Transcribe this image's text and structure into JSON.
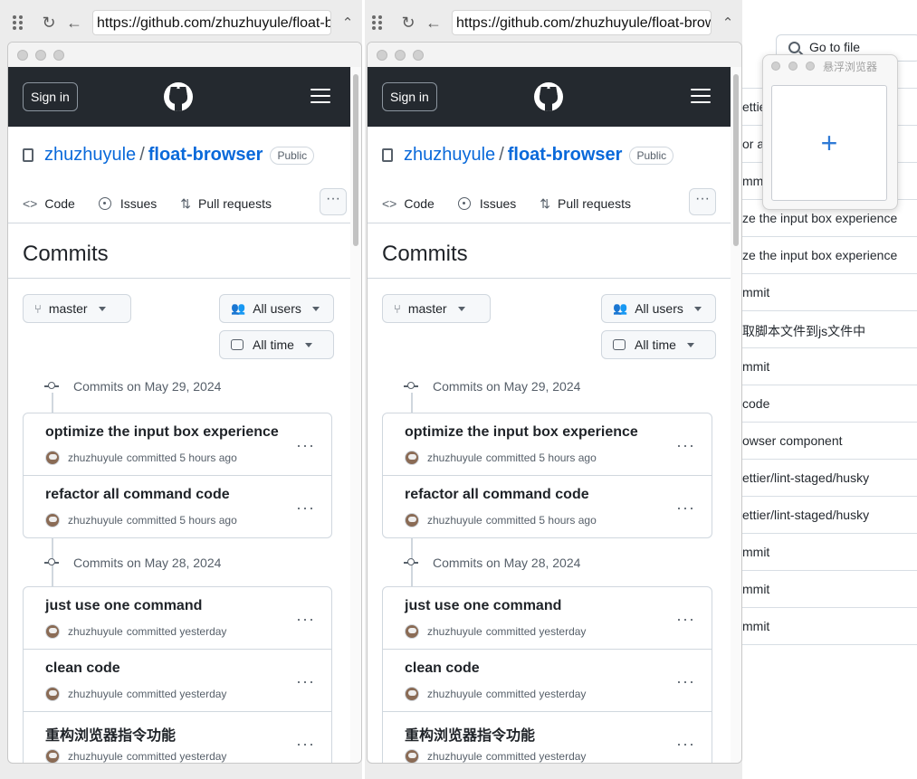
{
  "background_page": {
    "go_to_file": "Go to file",
    "rows": [
      "ettier",
      "or all",
      "mmit",
      "ze the input box experience",
      "ze the input box experience",
      "mmit",
      "取脚本文件到js文件中",
      "mmit",
      "code",
      "owser component",
      "ettier/lint-staged/husky",
      "ettier/lint-staged/husky",
      "mmit",
      "mmit",
      "mmit"
    ]
  },
  "window1": {
    "url": "https://github.com/zhuzhuyule/float-browser/commits/master/"
  },
  "window2": {
    "url": "https://github.com/zhuzhuyule/float-browser/commits/master/"
  },
  "github": {
    "sign_in": "Sign in",
    "owner": "zhuzhuyule",
    "slash": "/",
    "repo": "float-browser",
    "visibility": "Public",
    "nav": {
      "code": "Code",
      "issues": "Issues",
      "pull_requests": "Pull requests",
      "more": "···"
    },
    "heading": "Commits",
    "branch": "master",
    "users": "All users",
    "time": "All time",
    "groups": [
      {
        "date": "Commits on May 29, 2024",
        "commits": [
          {
            "message": "optimize the input box experience",
            "author": "zhuzhuyule",
            "when": "committed 5 hours ago"
          },
          {
            "message": "refactor all command code",
            "author": "zhuzhuyule",
            "when": "committed 5 hours ago"
          }
        ]
      },
      {
        "date": "Commits on May 28, 2024",
        "commits": [
          {
            "message": "just use one command",
            "author": "zhuzhuyule",
            "when": "committed yesterday"
          },
          {
            "message": "clean code",
            "author": "zhuzhuyule",
            "when": "committed yesterday"
          },
          {
            "message": "重构浏览器指令功能",
            "author": "zhuzhuyule",
            "when": "committed yesterday"
          }
        ]
      }
    ],
    "row_more": "···"
  },
  "float_browser": {
    "title": "悬浮浏览器",
    "add": "+"
  },
  "colors": {
    "header": "#24292f",
    "link": "#0969da",
    "accent_plus": "#2f7ad6"
  }
}
